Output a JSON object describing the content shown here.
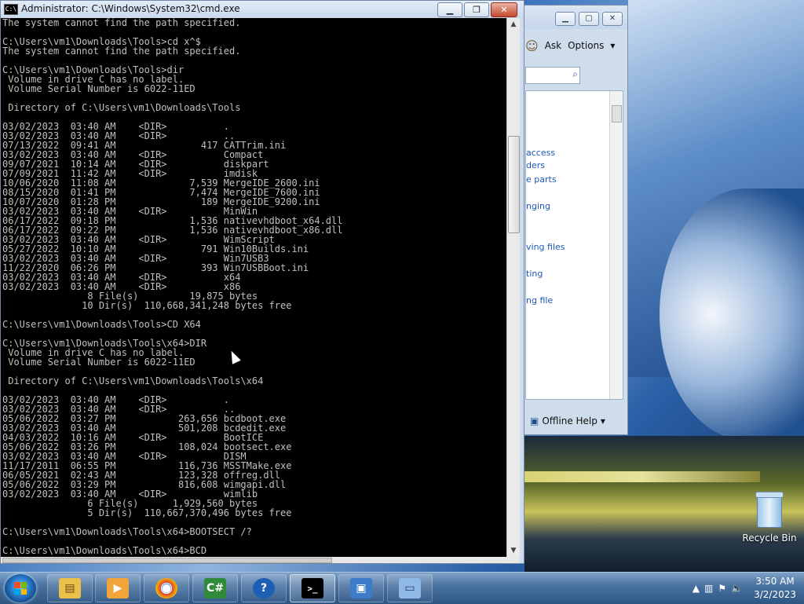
{
  "cmd": {
    "title": "Administrator: C:\\Windows\\System32\\cmd.exe",
    "icon": "cmd-icon",
    "controls": [
      "minimize",
      "restore",
      "close"
    ],
    "output": "The system cannot find the path specified.\n\nC:\\Users\\vm1\\Downloads\\Tools>cd x^$\nThe system cannot find the path specified.\n\nC:\\Users\\vm1\\Downloads\\Tools>dir\n Volume in drive C has no label.\n Volume Serial Number is 6022-11ED\n\n Directory of C:\\Users\\vm1\\Downloads\\Tools\n\n03/02/2023  03:40 AM    <DIR>          .\n03/02/2023  03:40 AM    <DIR>          ..\n07/13/2022  09:41 AM               417 CATTrim.ini\n03/02/2023  03:40 AM    <DIR>          Compact\n09/07/2021  10:14 AM    <DIR>          diskpart\n07/09/2021  11:42 AM    <DIR>          imdisk\n10/06/2020  11:08 AM             7,539 MergeIDE_2600.ini\n08/15/2020  01:41 PM             7,474 MergeIDE_7600.ini\n10/07/2020  01:28 PM               189 MergeIDE_9200.ini\n03/02/2023  03:40 AM    <DIR>          MinWin\n06/17/2022  09:18 PM             1,536 nativevhdboot_x64.dll\n06/17/2022  09:22 PM             1,536 nativevhdboot_x86.dll\n03/02/2023  03:40 AM    <DIR>          WimScript\n05/27/2022  10:10 AM               791 Win10Builds.ini\n03/02/2023  03:40 AM    <DIR>          Win7USB3\n11/22/2020  06:26 PM               393 Win7USBBoot.ini\n03/02/2023  03:40 AM    <DIR>          x64\n03/02/2023  03:40 AM    <DIR>          x86\n               8 File(s)         19,875 bytes\n              10 Dir(s)  110,668,341,248 bytes free\n\nC:\\Users\\vm1\\Downloads\\Tools>CD X64\n\nC:\\Users\\vm1\\Downloads\\Tools\\x64>DIR\n Volume in drive C has no label.\n Volume Serial Number is 6022-11ED\n\n Directory of C:\\Users\\vm1\\Downloads\\Tools\\x64\n\n03/02/2023  03:40 AM    <DIR>          .\n03/02/2023  03:40 AM    <DIR>          ..\n05/06/2022  03:27 PM           263,656 bcdboot.exe\n03/02/2023  03:40 AM           501,208 bcdedit.exe\n04/03/2022  10:16 AM    <DIR>          BootICE\n05/06/2022  03:26 PM           108,024 bootsect.exe\n03/02/2023  03:40 AM    <DIR>          DISM\n11/17/2011  06:55 PM           116,736 MSSTMake.exe\n06/05/2021  02:43 AM           123,328 offreg.dll\n05/06/2022  03:29 PM           816,608 wimgapi.dll\n03/02/2023  03:40 AM    <DIR>          wimlib\n               6 File(s)      1,929,560 bytes\n               5 Dir(s)  110,667,370,496 bytes free\n\nC:\\Users\\vm1\\Downloads\\Tools\\x64>BOOTSECT /?\n\nC:\\Users\\vm1\\Downloads\\Tools\\x64>BCD"
  },
  "help": {
    "toolbar": {
      "ask_label": "Ask",
      "options_label": "Options"
    },
    "links": [
      "access",
      "ders",
      "e parts",
      "nging",
      "ving files",
      "ting",
      "ng file"
    ],
    "offline_label": "Offline Help"
  },
  "desktop": {
    "recycle_bin_label": "Recycle Bin"
  },
  "taskbar": {
    "items": [
      {
        "name": "explorer",
        "icon": "folder-icon",
        "glyph": "▤"
      },
      {
        "name": "media-player",
        "icon": "media-player-icon",
        "glyph": "▶"
      },
      {
        "name": "chrome",
        "icon": "chrome-icon",
        "glyph": "●"
      },
      {
        "name": "csharp",
        "icon": "csharp-icon",
        "glyph": "C#"
      },
      {
        "name": "help",
        "icon": "help-icon",
        "glyph": "?"
      },
      {
        "name": "cmd",
        "icon": "cmd-icon",
        "glyph": ">_"
      },
      {
        "name": "remote",
        "icon": "network-icon",
        "glyph": "▣"
      },
      {
        "name": "vm",
        "icon": "vm-icon",
        "glyph": "▭"
      }
    ],
    "time": "3:50 AM",
    "date": "3/2/2023"
  }
}
